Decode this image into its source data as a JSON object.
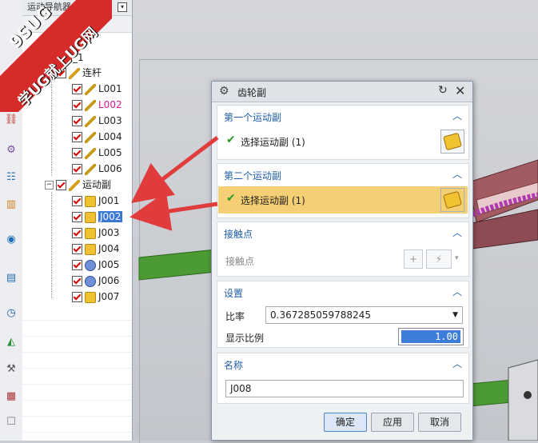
{
  "navigator": {
    "header": "运动导航器",
    "root_suffix": "tion_1",
    "links_group": "连杆",
    "links": [
      {
        "label": "L001",
        "highlight": false
      },
      {
        "label": "L002",
        "highlight": true
      },
      {
        "label": "L003",
        "highlight": false
      },
      {
        "label": "L004",
        "highlight": false
      },
      {
        "label": "L005",
        "highlight": false
      },
      {
        "label": "L006",
        "highlight": false
      }
    ],
    "joints_group": "运动副",
    "joints": [
      {
        "label": "J001",
        "icon": "gear-joint-icon",
        "selected": false
      },
      {
        "label": "J002",
        "icon": "gear-joint-icon",
        "selected": true
      },
      {
        "label": "J003",
        "icon": "revolute-joint-icon",
        "selected": false
      },
      {
        "label": "J004",
        "icon": "revolute-joint-icon",
        "selected": false
      },
      {
        "label": "J005",
        "icon": "slider-joint-icon",
        "selected": false
      },
      {
        "label": "J006",
        "icon": "slider-joint-icon",
        "selected": false
      },
      {
        "label": "J007",
        "icon": "revolute-joint-icon",
        "selected": false
      }
    ],
    "highlight_color": "#d81b8c",
    "selection_color": "#3a78d8"
  },
  "watermark": {
    "top": "9SUG",
    "bottom": "学UG就上UG网"
  },
  "dialog": {
    "title": "齿轮副",
    "first_joint": {
      "heading": "第一个运动副",
      "select_label": "选择运动副 (1)"
    },
    "second_joint": {
      "heading": "第二个运动副",
      "select_label": "选择运动副 (1)",
      "active_color": "#f5cf73"
    },
    "contact": {
      "heading": "接触点",
      "label": "接触点"
    },
    "settings": {
      "heading": "设置",
      "ratio_label": "比率",
      "ratio_value": "0.367285059788245",
      "display_label": "显示比例",
      "display_value": "1.00"
    },
    "name": {
      "heading": "名称",
      "value": "J008"
    },
    "buttons": {
      "ok": "确定",
      "apply": "应用",
      "cancel": "取消"
    }
  }
}
